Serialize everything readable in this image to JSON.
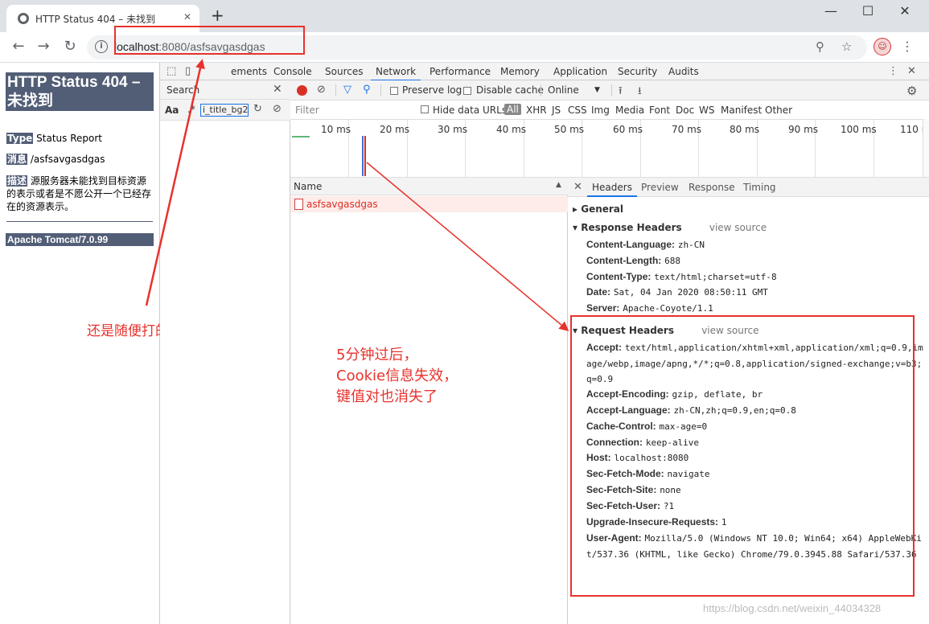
{
  "browser": {
    "tab_title": "HTTP Status 404 – 未找到",
    "tab_close": "✕",
    "new_tab": "+",
    "url_host": "localhost",
    "url_rest": ":8080/asfsavgasdgas",
    "window_controls": [
      "—",
      "☐",
      "✕"
    ]
  },
  "page": {
    "heading": "HTTP Status 404 – 未找到",
    "type_label": "Type",
    "type_value": "Status Report",
    "message_label": "消息",
    "message_value": "/asfsavgasdgas",
    "desc_label": "描述",
    "desc_value": "源服务器未能找到目标资源的表示或者是不愿公开一个已经存在的资源表示。",
    "footer": "Apache Tomcat/7.0.99"
  },
  "devtools": {
    "tabs": [
      "ements",
      "Console",
      "Sources",
      "Network",
      "Performance",
      "Memory",
      "Application",
      "Security",
      "Audits"
    ],
    "active_tab": "Network",
    "search": {
      "title": "Search",
      "aa": "Aa",
      "regex": ".*",
      "query": "i_title_bg2."
    },
    "network": {
      "preserve_log": "Preserve log",
      "disable_cache": "Disable cache",
      "throttle": "Online",
      "filter_placeholder": "Filter",
      "hide_data_urls": "Hide data URLs",
      "types": [
        "All",
        "XHR",
        "JS",
        "CSS",
        "Img",
        "Media",
        "Font",
        "Doc",
        "WS",
        "Manifest",
        "Other"
      ],
      "timeline_labels": [
        "10 ms",
        "20 ms",
        "30 ms",
        "40 ms",
        "50 ms",
        "60 ms",
        "70 ms",
        "80 ms",
        "90 ms",
        "100 ms",
        "110 m"
      ],
      "name_col": "Name",
      "requests": [
        "asfsavgasdgas"
      ]
    },
    "details": {
      "tabs": [
        "Headers",
        "Preview",
        "Response",
        "Timing"
      ],
      "active_tab": "Headers",
      "general": "General",
      "response_headers_title": "Response Headers",
      "view_source": "view source",
      "response_headers": [
        {
          "k": "Content-Language:",
          "v": "zh-CN"
        },
        {
          "k": "Content-Length:",
          "v": "688"
        },
        {
          "k": "Content-Type:",
          "v": "text/html;charset=utf-8"
        },
        {
          "k": "Date:",
          "v": "Sat, 04 Jan 2020 08:50:11 GMT"
        },
        {
          "k": "Server:",
          "v": "Apache-Coyote/1.1"
        }
      ],
      "request_headers_title": "Request Headers",
      "request_headers": [
        {
          "k": "Accept:",
          "v": "text/html,application/xhtml+xml,application/xml;q=0.9,image/webp,image/apng,*/*;q=0.8,application/signed-exchange;v=b3;q=0.9"
        },
        {
          "k": "Accept-Encoding:",
          "v": "gzip, deflate, br"
        },
        {
          "k": "Accept-Language:",
          "v": "zh-CN,zh;q=0.9,en;q=0.8"
        },
        {
          "k": "Cache-Control:",
          "v": "max-age=0"
        },
        {
          "k": "Connection:",
          "v": "keep-alive"
        },
        {
          "k": "Host:",
          "v": "localhost:8080"
        },
        {
          "k": "Sec-Fetch-Mode:",
          "v": "navigate"
        },
        {
          "k": "Sec-Fetch-Site:",
          "v": "none"
        },
        {
          "k": "Sec-Fetch-User:",
          "v": "?1"
        },
        {
          "k": "Upgrade-Insecure-Requests:",
          "v": "1"
        },
        {
          "k": "User-Agent:",
          "v": "Mozilla/5.0 (Windows NT 10.0; Win64; x64) AppleWebKit/537.36 (KHTML, like Gecko) Chrome/79.0.3945.88 Safari/537.36"
        }
      ]
    }
  },
  "annotations": {
    "left_note": "还是随便打的地址",
    "mid_note_lines": [
      "5分钟过后，",
      "Cookie信息失效，",
      "键值对也消失了"
    ],
    "color": "#e8322d"
  },
  "watermark": "https://blog.csdn.net/weixin_44034328"
}
